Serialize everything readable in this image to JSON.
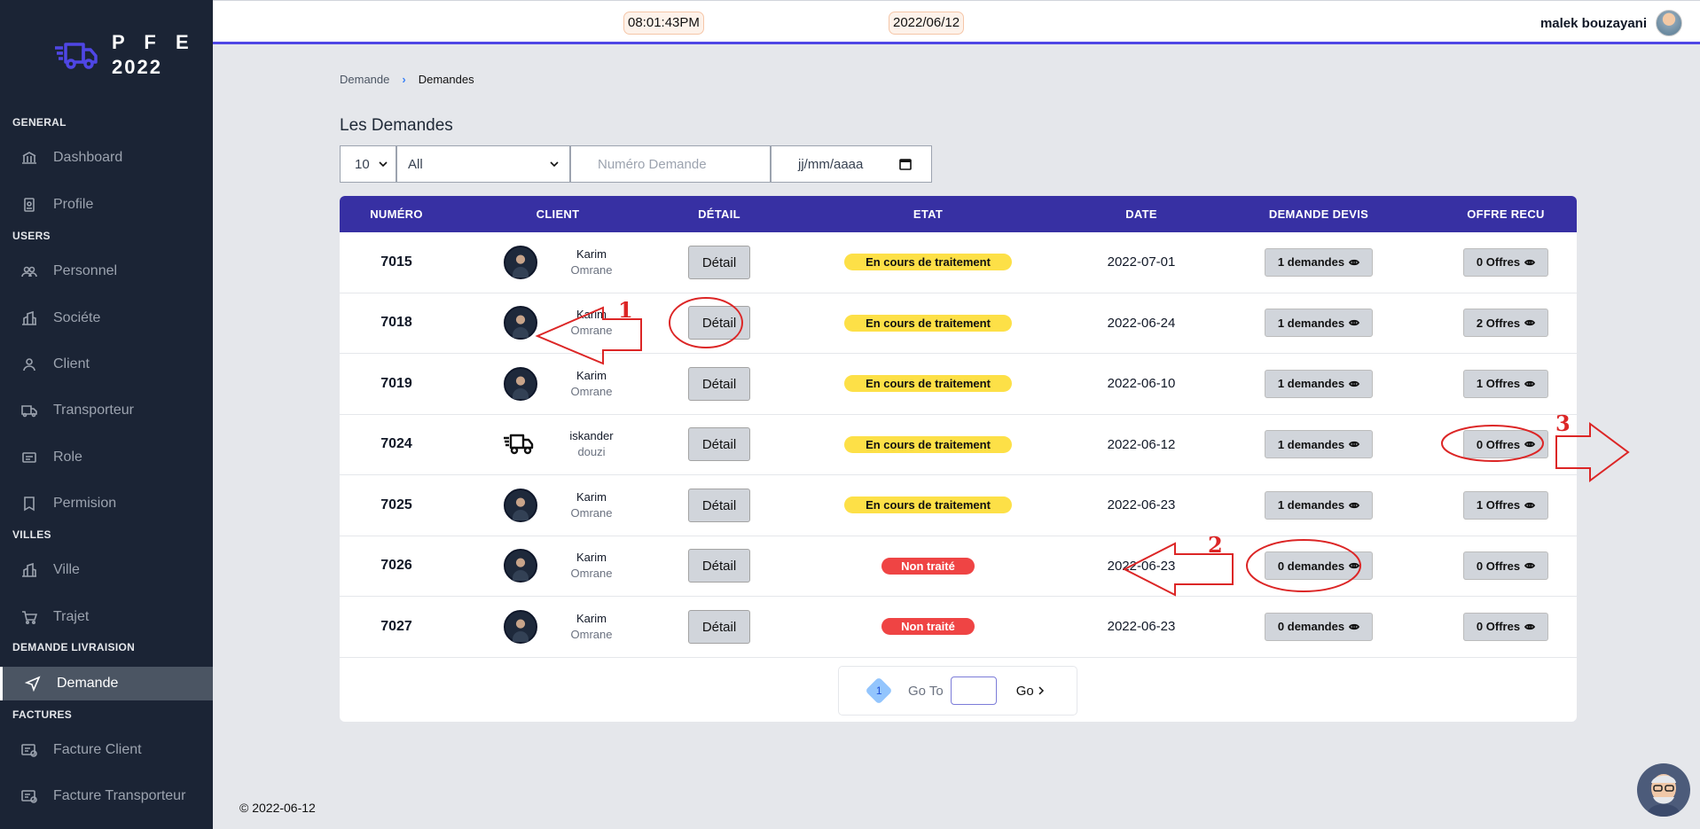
{
  "brand": {
    "line1": "P F E",
    "line2": "2022"
  },
  "sidebar": {
    "sections": [
      {
        "label": "GENERAL"
      },
      {
        "label": "USERS"
      },
      {
        "label": "VILLES"
      },
      {
        "label": "DEMANDE LIVRAISION"
      },
      {
        "label": "FACTURES"
      }
    ],
    "items": [
      {
        "label": "Dashboard",
        "icon": "bank-icon"
      },
      {
        "label": "Profile",
        "icon": "id-badge-icon"
      },
      {
        "label": "Personnel",
        "icon": "users-icon"
      },
      {
        "label": "Sociéte",
        "icon": "building-icon"
      },
      {
        "label": "Client",
        "icon": "user-icon"
      },
      {
        "label": "Transporteur",
        "icon": "truck-icon"
      },
      {
        "label": "Role",
        "icon": "card-icon"
      },
      {
        "label": "Permision",
        "icon": "bookmark-icon"
      },
      {
        "label": "Ville",
        "icon": "building-icon"
      },
      {
        "label": "Trajet",
        "icon": "cart-icon"
      },
      {
        "label": "Demande",
        "icon": "send-icon",
        "active": true
      },
      {
        "label": "Facture Client",
        "icon": "invoice-icon"
      },
      {
        "label": "Facture Transporteur",
        "icon": "invoice-icon"
      }
    ]
  },
  "topbar": {
    "time": "08:01:43PM",
    "date": "2022/06/12",
    "user": "malek bouzayani"
  },
  "breadcrumb": {
    "parent": "Demande",
    "current": "Demandes"
  },
  "page": {
    "title": "Les Demandes"
  },
  "filters": {
    "page_size": "10",
    "status": "All",
    "numero_placeholder": "Numéro Demande",
    "date_placeholder": "jj/mm/aaaa"
  },
  "table": {
    "headers": [
      "NUMÉRO",
      "CLIENT",
      "DÉTAIL",
      "ETAT",
      "DATE",
      "DEMANDE DEVIS",
      "OFFRE RECU"
    ],
    "rows": [
      {
        "numero": "7015",
        "first": "Karim",
        "last": "Omrane",
        "avatar": "photo",
        "detail": "Détail",
        "etat": "En cours de traitement",
        "etat_color": "yellow",
        "date": "2022-07-01",
        "devis": "1 demandes",
        "offres": "0 Offres"
      },
      {
        "numero": "7018",
        "first": "Karim",
        "last": "Omrane",
        "avatar": "photo",
        "detail": "Détail",
        "etat": "En cours de traitement",
        "etat_color": "yellow",
        "date": "2022-06-24",
        "devis": "1 demandes",
        "offres": "2 Offres"
      },
      {
        "numero": "7019",
        "first": "Karim",
        "last": "Omrane",
        "avatar": "photo",
        "detail": "Détail",
        "etat": "En cours de traitement",
        "etat_color": "yellow",
        "date": "2022-06-10",
        "devis": "1 demandes",
        "offres": "1 Offres"
      },
      {
        "numero": "7024",
        "first": "iskander",
        "last": "douzi",
        "avatar": "truck",
        "detail": "Détail",
        "etat": "En cours de traitement",
        "etat_color": "yellow",
        "date": "2022-06-12",
        "devis": "1 demandes",
        "offres": "0 Offres"
      },
      {
        "numero": "7025",
        "first": "Karim",
        "last": "Omrane",
        "avatar": "photo",
        "detail": "Détail",
        "etat": "En cours de traitement",
        "etat_color": "yellow",
        "date": "2022-06-23",
        "devis": "1 demandes",
        "offres": "1 Offres"
      },
      {
        "numero": "7026",
        "first": "Karim",
        "last": "Omrane",
        "avatar": "photo",
        "detail": "Détail",
        "etat": "Non traité",
        "etat_color": "red",
        "date": "2022-06-23",
        "devis": "0 demandes",
        "offres": "0 Offres"
      },
      {
        "numero": "7027",
        "first": "Karim",
        "last": "Omrane",
        "avatar": "photo",
        "detail": "Détail",
        "etat": "Non traité",
        "etat_color": "red",
        "date": "2022-06-23",
        "devis": "0 demandes",
        "offres": "0 Offres"
      }
    ]
  },
  "pagination": {
    "current": "1",
    "goto_label": "Go To",
    "go_label": "Go"
  },
  "footer": {
    "text": "© 2022-06-12"
  },
  "annotations": {
    "label1": "1",
    "label2": "2",
    "label3": "3",
    "color": "#dc2626"
  },
  "colors": {
    "sidebar": "#1b2435",
    "table_header": "#3730a3",
    "accent": "#4f46e5",
    "yellow": "#fde047",
    "red": "#ef4444"
  }
}
